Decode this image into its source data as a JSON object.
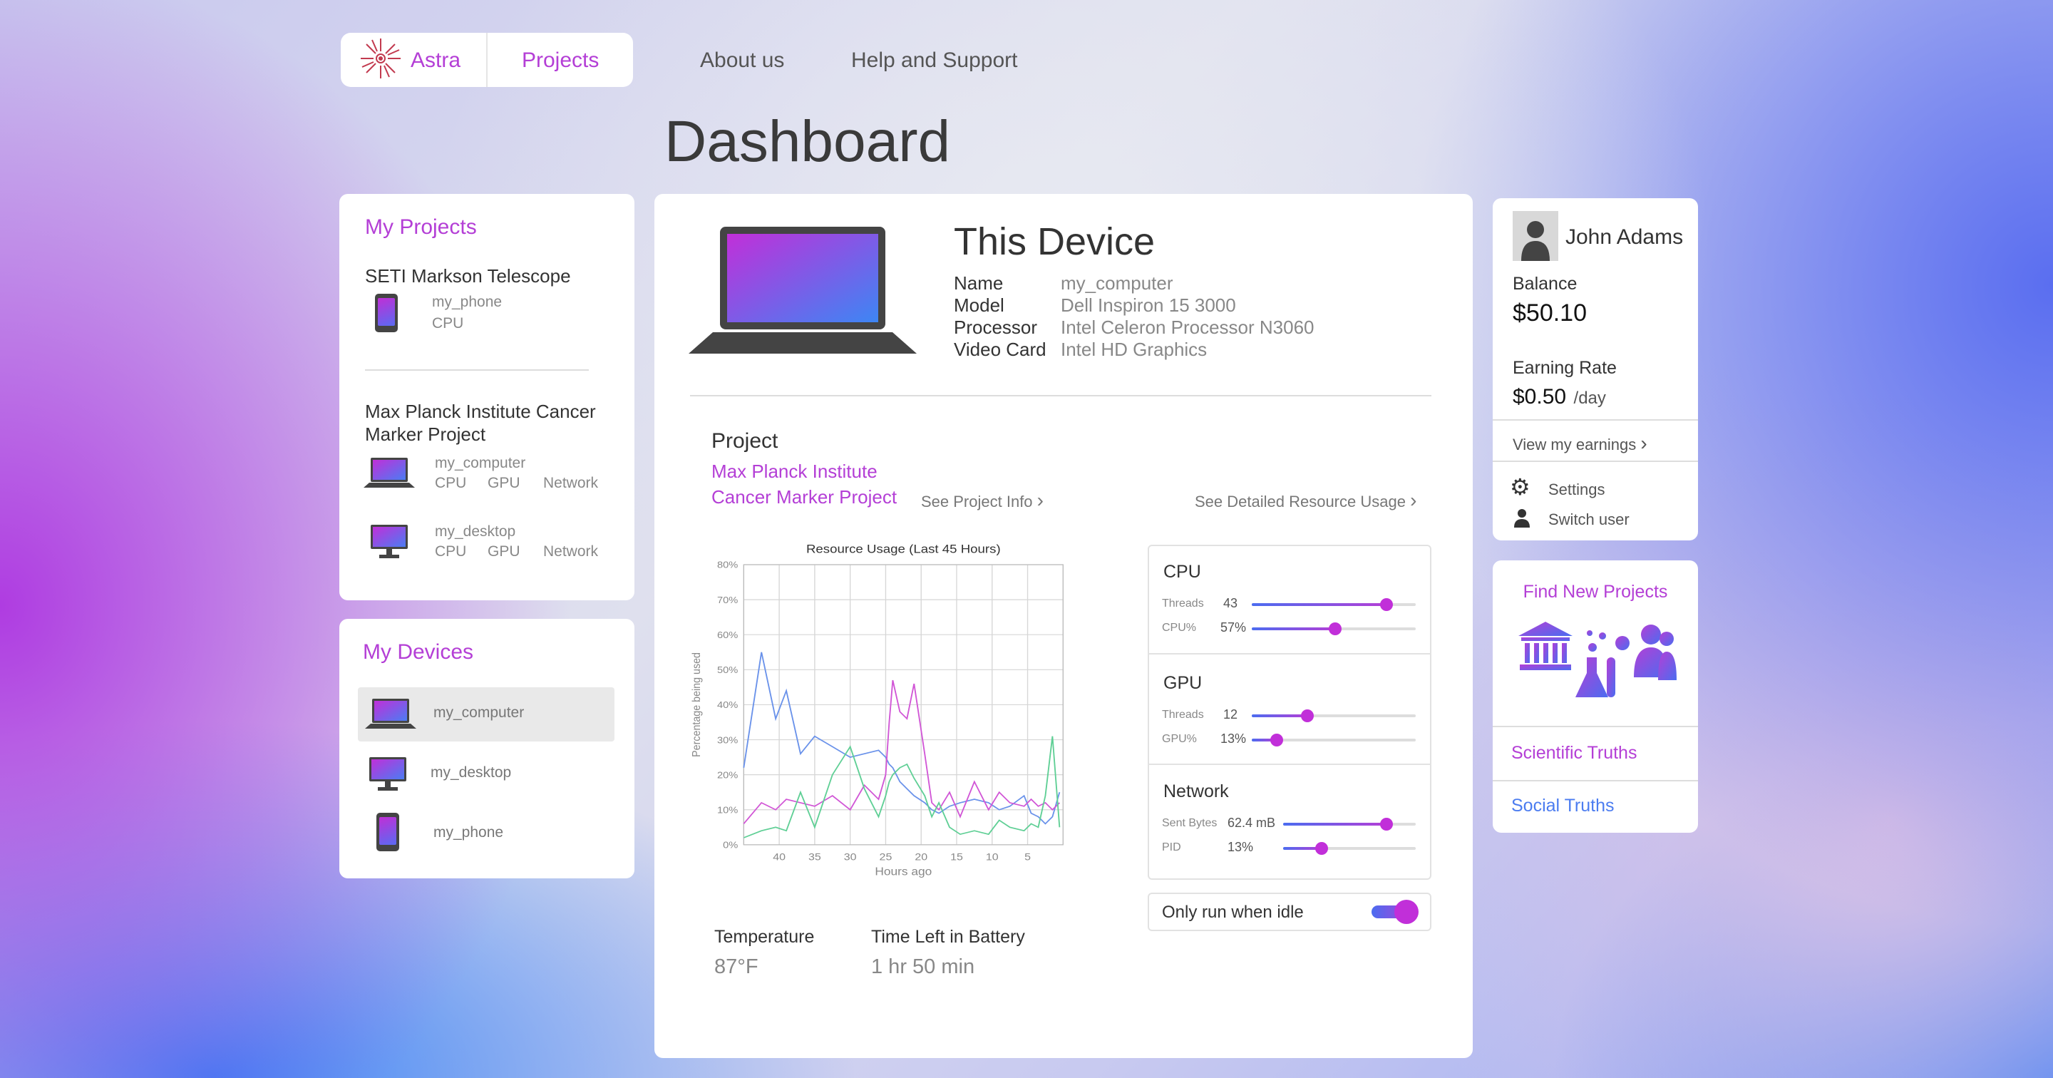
{
  "nav": {
    "brand": "Astra",
    "projects": "Projects",
    "about": "About us",
    "help": "Help and Support"
  },
  "page_title": "Dashboard",
  "my_projects": {
    "title": "My Projects",
    "projects": [
      {
        "name": "SETI Markson Telescope",
        "devices": [
          {
            "name": "my_phone",
            "resources": [
              "CPU"
            ]
          }
        ]
      },
      {
        "name_line1": "Max Planck Institute Cancer",
        "name_line2": "Marker Project",
        "devices": [
          {
            "name": "my_computer",
            "resources": [
              "CPU",
              "GPU",
              "Network"
            ]
          },
          {
            "name": "my_desktop",
            "resources": [
              "CPU",
              "GPU",
              "Network"
            ]
          }
        ]
      }
    ]
  },
  "my_devices": {
    "title": "My Devices",
    "items": [
      {
        "name": "my_computer",
        "icon": "laptop-icon",
        "selected": true
      },
      {
        "name": "my_desktop",
        "icon": "desktop-icon",
        "selected": false
      },
      {
        "name": "my_phone",
        "icon": "phone-icon",
        "selected": false
      }
    ]
  },
  "device": {
    "title": "This Device",
    "specs": [
      {
        "label": "Name",
        "value": "my_computer"
      },
      {
        "label": "Model",
        "value": "Dell Inspiron 15 3000"
      },
      {
        "label": "Processor",
        "value": "Intel Celeron Processor N3060"
      },
      {
        "label": "Video Card",
        "value": "Intel HD Graphics"
      }
    ]
  },
  "project": {
    "heading": "Project",
    "name_line1": "Max Planck Institute",
    "name_line2": "Cancer Marker Project",
    "info_link": "See Project Info",
    "usage_link": "See Detailed Resource Usage"
  },
  "chart_data": {
    "type": "line",
    "title": "Resource Usage (Last 45 Hours)",
    "xlabel": "Hours ago",
    "ylabel": "Percentage being used",
    "x_ticks": [
      "40",
      "35",
      "30",
      "25",
      "20",
      "15",
      "10",
      "5"
    ],
    "y_ticks": [
      "80%",
      "70%",
      "60%",
      "50%",
      "40%",
      "30%",
      "20%",
      "10%",
      "0%"
    ],
    "xlim": [
      45,
      0
    ],
    "ylim": [
      0,
      80
    ],
    "grid": true,
    "x": [
      45,
      42.5,
      40.5,
      39,
      37,
      35,
      32.5,
      30,
      28,
      26,
      25,
      24.5,
      24,
      23,
      22,
      21,
      19.5,
      18.5,
      17.5,
      16,
      14.5,
      12.5,
      10.5,
      9,
      7.5,
      5.5,
      4.5,
      3.5,
      2.5,
      1.5,
      0.5
    ],
    "series": [
      {
        "color": "#6a92ea",
        "values": [
          22,
          55,
          36,
          44,
          26,
          31,
          28,
          25,
          26,
          27,
          25,
          23,
          22,
          18,
          16,
          14,
          12,
          10,
          9,
          11,
          12,
          13,
          12,
          10,
          11,
          14,
          9,
          8,
          6,
          8,
          15
        ]
      },
      {
        "color": "#d156d6",
        "values": [
          6,
          12,
          10,
          13,
          12,
          11,
          14,
          10,
          17,
          13,
          20,
          35,
          47,
          38,
          36,
          46,
          26,
          12,
          10,
          15,
          8,
          18,
          10,
          15,
          12,
          11,
          13,
          11,
          12,
          10,
          12
        ]
      },
      {
        "color": "#5fcf95",
        "values": [
          2,
          4,
          5,
          4,
          15,
          5,
          20,
          28,
          16,
          8,
          14,
          18,
          20,
          22,
          23,
          19,
          14,
          8,
          12,
          5,
          3,
          4,
          3,
          7,
          5,
          4,
          6,
          5,
          14,
          31,
          5
        ]
      }
    ]
  },
  "stats": {
    "temp_label": "Temperature",
    "temp_value": "87°F",
    "battery_label": "Time Left in Battery",
    "battery_value": "1 hr 50 min"
  },
  "resources": {
    "cpu": {
      "title": "CPU",
      "rows": [
        {
          "label": "Threads",
          "value": "43",
          "level": 0.82
        },
        {
          "label": "CPU%",
          "value": "57%",
          "level": 0.51
        }
      ]
    },
    "gpu": {
      "title": "GPU",
      "rows": [
        {
          "label": "Threads",
          "value": "12",
          "level": 0.34
        },
        {
          "label": "GPU%",
          "value": "13%",
          "level": 0.15
        }
      ]
    },
    "network": {
      "title": "Network",
      "rows": [
        {
          "label": "Sent Bytes",
          "value": "62.4 mB",
          "level": 0.78
        },
        {
          "label": "PID",
          "value": "13%",
          "level": 0.29
        }
      ]
    },
    "idle_toggle": {
      "label": "Only run when idle",
      "on": true
    }
  },
  "user": {
    "name": "John Adams",
    "balance_label": "Balance",
    "balance": "$50.10",
    "rate_label": "Earning Rate",
    "rate": "$0.50",
    "rate_unit": "/day",
    "earnings_link": "View my earnings",
    "settings": "Settings",
    "switch_user": "Switch user"
  },
  "find_projects": {
    "title": "Find New Projects",
    "links": [
      "Scientific Truths",
      "Social Truths"
    ]
  },
  "colors": {
    "accent": "#b43fd6",
    "blue": "#4b6cf0"
  }
}
